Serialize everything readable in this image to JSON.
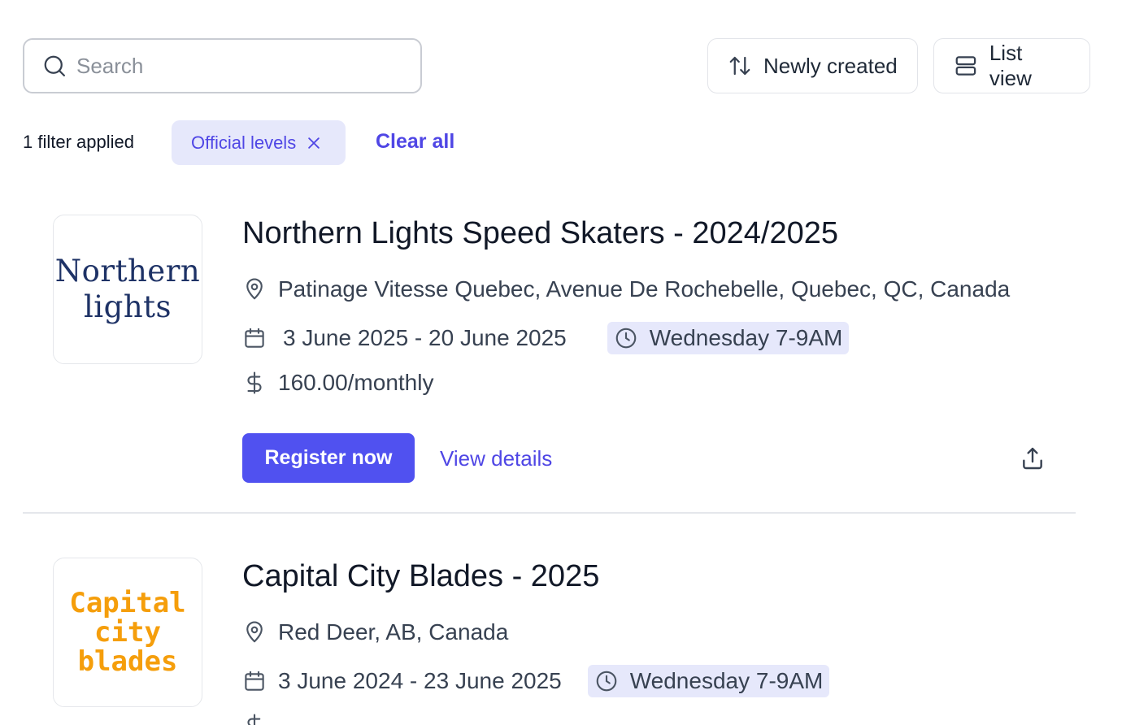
{
  "search": {
    "placeholder": "Search",
    "icon": "search-icon"
  },
  "toolbar": {
    "sort_label": "Newly created",
    "sort_icon": "sort-arrows-icon",
    "view_label": "List view",
    "view_icon": "list-view-icon"
  },
  "filters": {
    "count_text": "1 filter applied",
    "chips": [
      {
        "label": "Official levels"
      }
    ],
    "clear_all_label": "Clear all"
  },
  "listings": [
    {
      "logo_lines": [
        "Northern",
        "lights"
      ],
      "logo_color": "#1e3266",
      "title": "Northern Lights Speed Skaters - 2024/2025",
      "location": "Patinage Vitesse Quebec, Avenue De Rochebelle, Quebec, QC, Canada",
      "dates": "3 June 2025 - 20 June 2025",
      "schedule": "Wednesday 7-9AM",
      "price": "160.00/monthly",
      "register_label": "Register now",
      "details_label": "View details"
    },
    {
      "logo_lines": [
        "Capital",
        "city",
        "blades"
      ],
      "logo_color": "#f59e0b",
      "title": "Capital City Blades - 2025",
      "location": "Red Deer, AB, Canada",
      "dates": "3 June 2024 - 23 June 2025",
      "schedule": "Wednesday 7-9AM"
    }
  ],
  "colors": {
    "accent": "#4f46e5",
    "primary_button": "#5051f0",
    "chip_bg": "#e6e8fb"
  }
}
